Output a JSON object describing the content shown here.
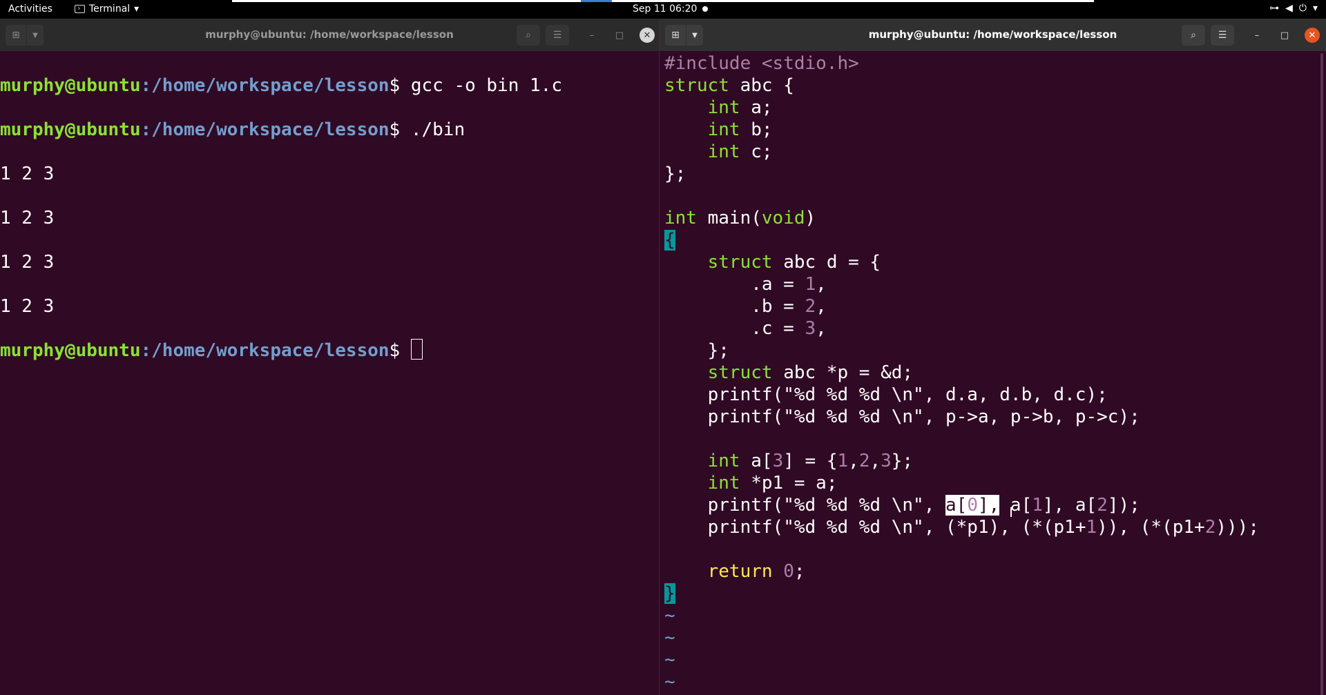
{
  "topbar": {
    "activities": "Activities",
    "app_name": "Terminal",
    "app_menu_arrow": "▾",
    "clock": "Sep 11  06:20",
    "icons": [
      "network-icon",
      "volume-icon",
      "power-icon",
      "chevron-down-icon"
    ]
  },
  "left_window": {
    "title": "murphy@ubuntu: /home/workspace/lesson",
    "lines": [
      {
        "user": "murphy@ubuntu",
        "path": ":/home/workspace/lesson",
        "cmd": "$ gcc -o bin 1.c"
      },
      {
        "user": "murphy@ubuntu",
        "path": ":/home/workspace/lesson",
        "cmd": "$ ./bin"
      },
      {
        "output": "1 2 3"
      },
      {
        "output": "1 2 3"
      },
      {
        "output": "1 2 3"
      },
      {
        "output": "1 2 3"
      },
      {
        "user": "murphy@ubuntu",
        "path": ":/home/workspace/lesson",
        "cmd": "$ "
      }
    ]
  },
  "right_window": {
    "title": "murphy@ubuntu: /home/workspace/lesson",
    "tilde": "~"
  },
  "colors": {
    "terminal_bg": "#300a24",
    "prompt_user": "#8ae234",
    "prompt_path": "#729fcf",
    "close_button": "#e95420"
  }
}
